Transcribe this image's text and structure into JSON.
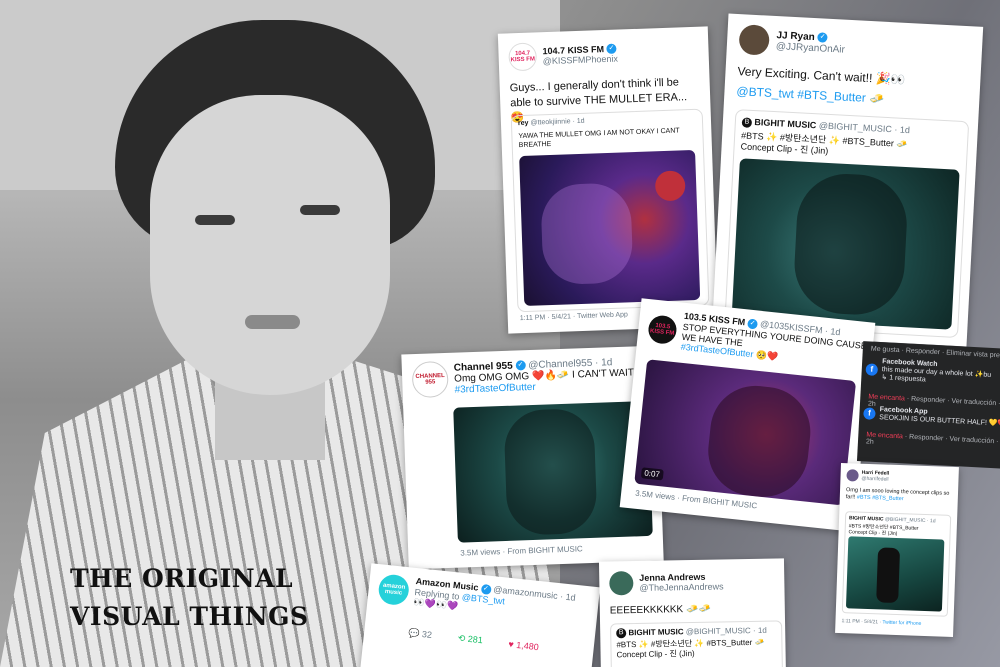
{
  "caption": {
    "line1": "THE ORIGINAL",
    "line2": "VISUAL THINGS"
  },
  "tweets": {
    "kissfm_phoenix": {
      "avatar": "104.7 KISS FM",
      "name": "104.7 KISS FM",
      "handle": "@KISSFMPhoenix",
      "text": "Guys... I generally don't think i'll be able to survive THE MULLET ERA...",
      "quote_name": "rey",
      "quote_handle": "@tteokjiinnie · 1d",
      "quote_text": "YAWA THE MULLET OMG I AM NOT OKAY I CANT BREATHE",
      "footer": "1:11 PM · 5/4/21 · Twitter Web App"
    },
    "jjryan": {
      "name": "JJ Ryan",
      "handle": "@JJRyanOnAir",
      "text": "Very Exciting.  Can't wait!!",
      "tags": "@BTS_twt #BTS_Butter",
      "quote_name": "BIGHIT MUSIC",
      "quote_handle": "@BIGHIT_MUSIC · 1d",
      "quote_tags": "#BTS",
      "quote_line1": "#방탄소년단",
      "quote_line1b": "#BTS_Butter",
      "quote_line2": "Concept Clip - 진 (Jin)"
    },
    "channel955": {
      "avatar": "CHANNEL 955",
      "name": "Channel 955",
      "handle": "@Channel955 · 1d",
      "text": "Omg OMG OMG",
      "text2": "I CAN'T WAIT",
      "tag": "#3rdTasteOfButter",
      "footer": "3.5M views · From BIGHIT MUSIC"
    },
    "kissfm1035": {
      "avatar": "103.5 KISS FM",
      "name": "103.5 KISS FM",
      "handle": "@1035KISSFM · 1d",
      "text": "STOP EVERYTHING YOURE DOING CAUSE WE HAVE THE",
      "tag": "#3rdTasteOfButter",
      "time": "0:07",
      "footer": "3.5M views · From BIGHIT MUSIC"
    },
    "amazon": {
      "avatar": "amazon music",
      "name": "Amazon Music",
      "handle": "@amazonmusic · 1d",
      "reply": "Replying to",
      "reply_to": "@BTS_twt",
      "stat1": "32",
      "stat2": "281",
      "stat3": "1,480"
    },
    "jenna": {
      "name": "Jenna Andrews",
      "handle": "@TheJennaAndrews",
      "text": "EEEEEKKKKKK",
      "quote_name": "BIGHIT MUSIC",
      "quote_handle": "@BIGHIT_MUSIC · 1d",
      "quote_tags": "#BTS",
      "quote_line1": "#방탄소년단",
      "quote_line1b": "#BTS_Butter",
      "quote_line2": "Concept Clip - 진 (Jin)"
    },
    "small": {
      "name": "Harri Fedell",
      "handle": "@harrifedell",
      "text": "Omg I am sooo loving the concept clips so far!!",
      "tag": "#BTS",
      "tag2": "#BTS_Butter",
      "quote_name": "BIGHIT MUSIC",
      "quote_handle": "@BIGHIT_MUSIC · 1d",
      "quote_line1": "#BTS #방탄소년단 #BTS_Butter",
      "quote_line2": "Concept Clip - 진 (Jin)",
      "footer_left": "1:11 PM · 5/4/21",
      "footer_right": "Twitter for iPhone"
    }
  },
  "facebook": {
    "top": "Me gusta · Responder · Eliminar vista pre",
    "c1_name": "Facebook Watch",
    "c1_text": "this made our day a whole lot",
    "c1_tail": "bu",
    "c1_reply_count": "1 respuesta",
    "c1_actions_prefix": "Me encanta",
    "c1_actions": " · Responder · Ver traducción · 2h",
    "c2_name": "Facebook App",
    "c2_text": "SEOKJIN IS OUR BUTTER HALF!",
    "c2_actions_prefix": "Me encanta",
    "c2_actions": " · Responder · Ver traducción · 2h"
  },
  "colors": {
    "twitter_blue": "#1d9bf0",
    "facebook_blue": "#1877f2",
    "dark_panel": "#242526"
  },
  "icons": [
    "verified-badge-icon",
    "reply-icon",
    "retweet-icon",
    "like-icon",
    "facebook-badge-icon"
  ]
}
